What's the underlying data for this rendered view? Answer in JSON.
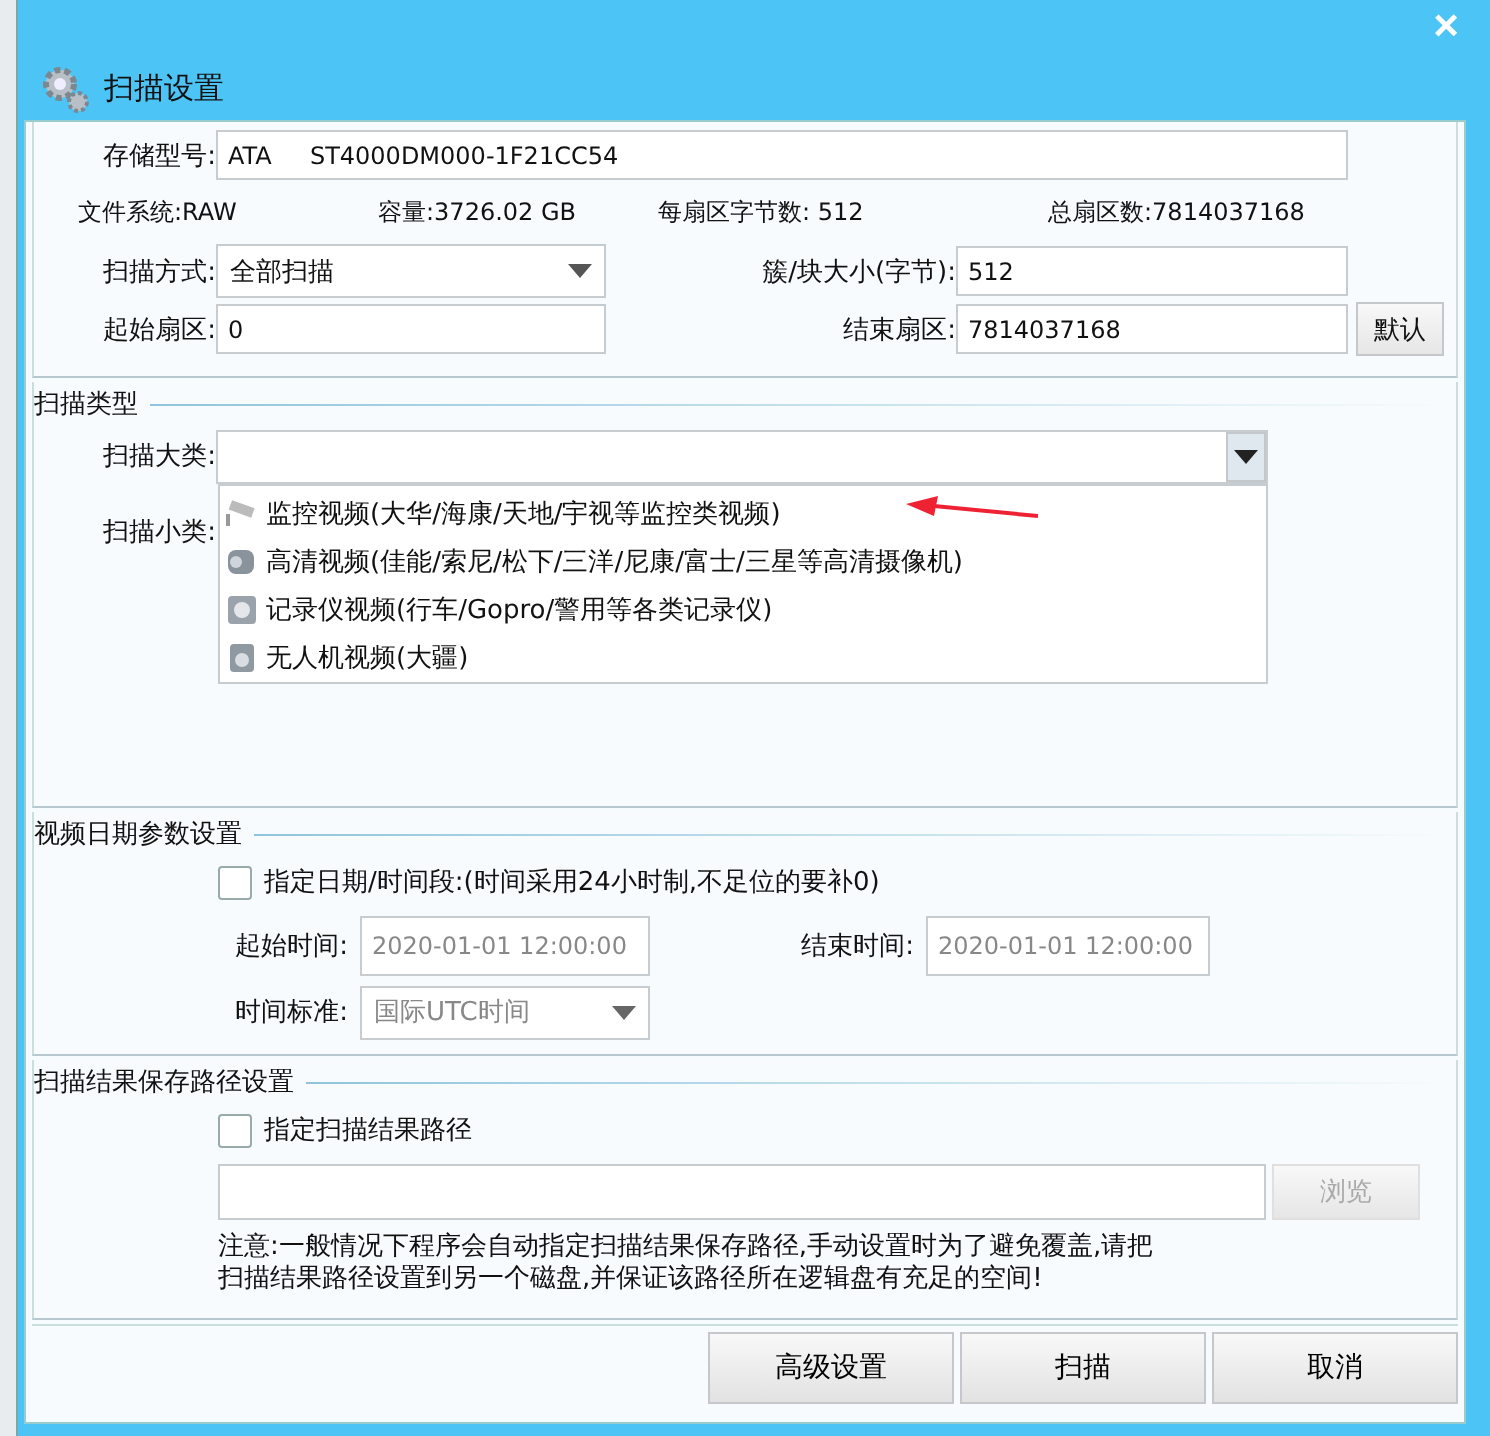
{
  "dialog": {
    "title": "扫描设置",
    "close": "×"
  },
  "disk": {
    "model_label": "存储型号:",
    "model": "ATA     ST4000DM000-1F21CC54",
    "info": [
      {
        "label": "文件系统:",
        "value": "RAW"
      },
      {
        "label": "容量:",
        "value": "3726.02 GB"
      },
      {
        "label": "每扇区字节数:",
        "value": " 512"
      },
      {
        "label": "总扇区数:",
        "value": "7814037168"
      }
    ],
    "scan_mode_label": "扫描方式:",
    "scan_mode": "全部扫描",
    "block_label": "簇/块大小(字节):",
    "block": "512",
    "start_label": "起始扇区:",
    "start": "0",
    "end_label": "结束扇区:",
    "end": "7814037168",
    "default_button": "默认"
  },
  "scan_type": {
    "title": "扫描类型",
    "category_label": "扫描大类:",
    "subcategory_label": "扫描小类:",
    "dropdown_items": [
      {
        "label": "监控视频(大华/海康/天地/宇视等监控类视频)",
        "kind": "cctv"
      },
      {
        "label": "高清视频(佳能/索尼/松下/三洋/尼康/富士/三星等高清摄像机)",
        "kind": "camcorder"
      },
      {
        "label": "记录仪视频(行车/Gopro/警用等各类记录仪)",
        "kind": "recorder"
      },
      {
        "label": "无人机视频(大疆)",
        "kind": "drone"
      }
    ]
  },
  "date": {
    "title": "视频日期参数设置",
    "checkbox": {
      "label": "指定日期/时间段:(时间采用24小时制,不足位的要补0)",
      "checked": false
    },
    "start_label": "起始时间:",
    "start": "2020-01-01 12:00:00",
    "end_label": "结束时间:",
    "end": "2020-01-01 12:00:00",
    "standard_label": "时间标准:",
    "standard": "国际UTC时间",
    "disabled": true
  },
  "path": {
    "title": "扫描结果保存路径设置",
    "checkbox": {
      "label": "指定扫描结果路径",
      "checked": false
    },
    "browse": "浏览",
    "browse_disabled": true,
    "note_lines": [
      "注意:一般情况下程序会自动指定扫描结果保存路径,手动设置时为了避免覆盖,请把",
      "扫描结果路径设置到另一个磁盘,并保证该路径所在逻辑盘有充足的空间!"
    ]
  },
  "buttons": [
    "高级设置",
    "扫描",
    "取消"
  ]
}
